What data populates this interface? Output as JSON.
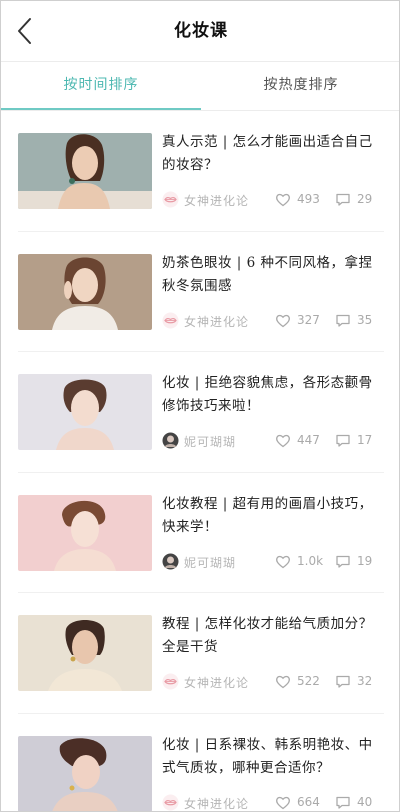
{
  "header": {
    "title": "化妆课",
    "back_icon": "chevron-left-icon"
  },
  "tabs": [
    {
      "label": "按时间排序",
      "active": true
    },
    {
      "label": "按热度排序",
      "active": false
    }
  ],
  "colors": {
    "accent": "#4db8b1",
    "indicator": "#6fcac4",
    "muted": "#aaaaaa"
  },
  "articles": [
    {
      "title": "真人示范 | 怎么才能画出适合自己的妆容？",
      "author": "女神进化论",
      "author_icon": "brand-lips-icon",
      "likes": "493",
      "comments": "29"
    },
    {
      "title": "奶茶色眼妆 | 6 种不同风格，拿捏秋冬氛围感",
      "author": "女神进化论",
      "author_icon": "brand-lips-icon",
      "likes": "327",
      "comments": "35"
    },
    {
      "title": "化妆 | 拒绝容貌焦虑，各形态颧骨修饰技巧来啦！",
      "author": "妮可瑚瑚",
      "author_icon": "user-avatar-icon",
      "likes": "447",
      "comments": "17"
    },
    {
      "title": "化妆教程 | 超有用的画眉小技巧，快来学！",
      "author": "妮可瑚瑚",
      "author_icon": "user-avatar-icon",
      "likes": "1.0k",
      "comments": "19"
    },
    {
      "title": "教程 | 怎样化妆才能给气质加分？全是干货",
      "author": "女神进化论",
      "author_icon": "brand-lips-icon",
      "likes": "522",
      "comments": "32"
    },
    {
      "title": "化妆 | 日系裸妆、韩系明艳妆、中式气质妆，哪种更合适你？",
      "author": "女神进化论",
      "author_icon": "brand-lips-icon",
      "likes": "664",
      "comments": "40"
    }
  ]
}
